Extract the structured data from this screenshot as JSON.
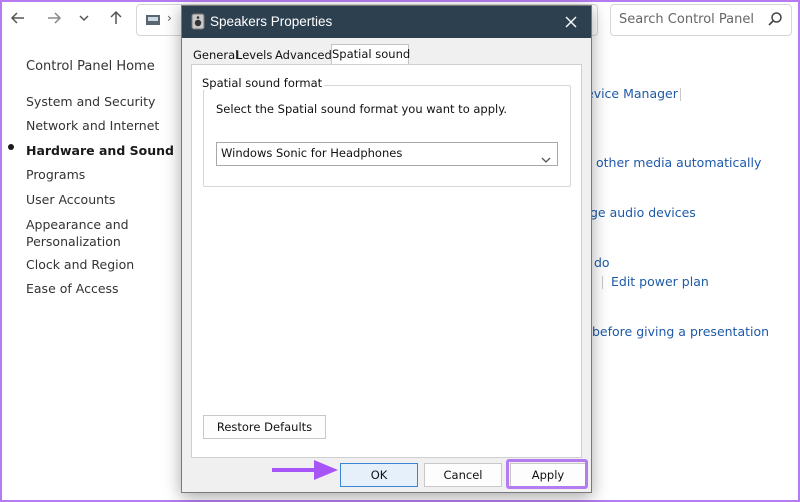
{
  "control_panel": {
    "search_placeholder": "Search Control Panel",
    "nav": {
      "home": "Control Panel Home",
      "items": [
        "System and Security",
        "Network and Internet",
        "Hardware and Sound",
        "Programs",
        "User Accounts",
        "Appearance and",
        "Personalization",
        "Clock and Region",
        "Ease of Access"
      ],
      "active": "Hardware and Sound"
    },
    "right_links": [
      "evice Manager",
      "other media automatically",
      "ge audio devices",
      "do",
      "Edit power plan",
      "before giving a presentation"
    ]
  },
  "dialog": {
    "title": "Speakers Properties",
    "tabs": [
      "General",
      "Levels",
      "Advanced",
      "Spatial sound"
    ],
    "active_tab": "Spatial sound",
    "group_label": "Spatial sound format",
    "description": "Select the Spatial sound format you want to apply.",
    "format_selected": "Windows Sonic for Headphones",
    "restore_defaults": "Restore Defaults",
    "ok": "OK",
    "cancel": "Cancel",
    "apply": "Apply"
  },
  "colors": {
    "titlebar": "#2d4050",
    "link": "#1e5aa8",
    "annotation": "#b57cf2"
  },
  "icons": [
    "back-arrow-icon",
    "forward-arrow-icon",
    "chevron-down-icon",
    "up-arrow-icon",
    "control-panel-icon",
    "search-icon",
    "speaker-icon",
    "close-icon"
  ]
}
